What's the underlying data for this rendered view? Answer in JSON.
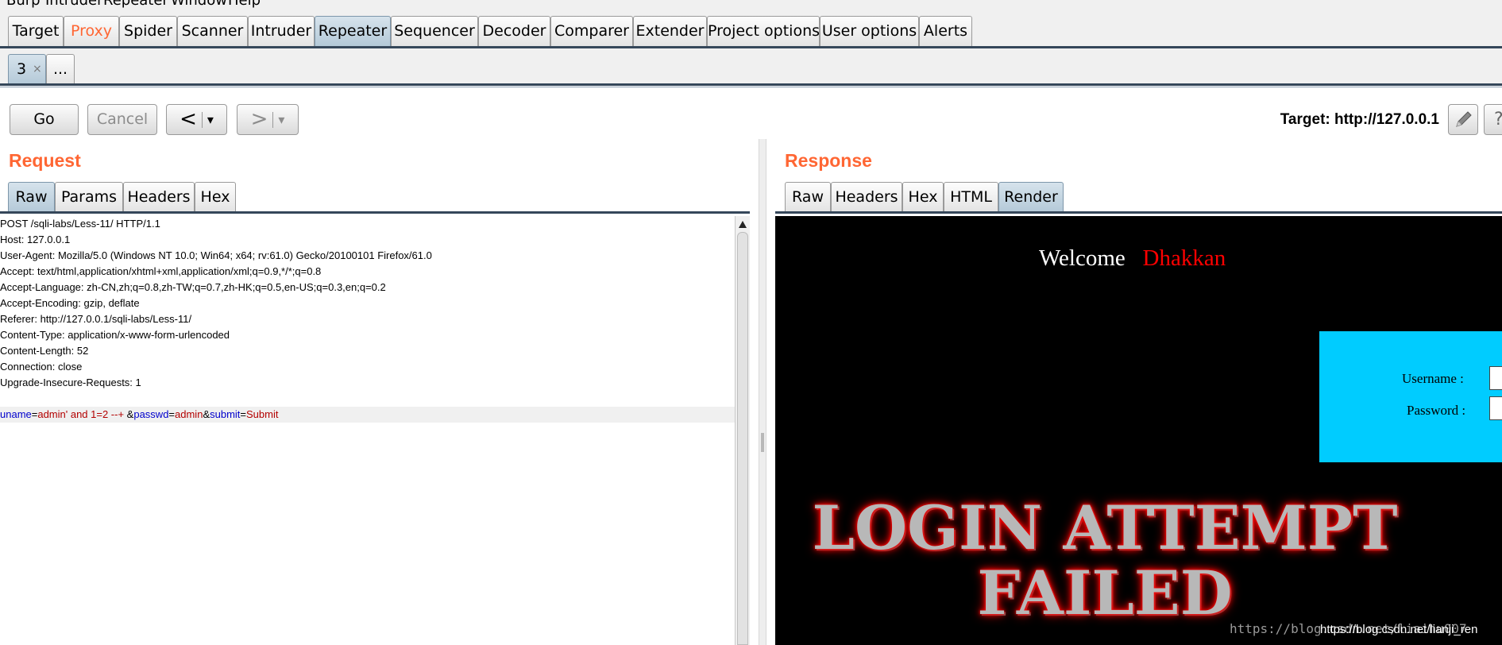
{
  "menubar": {
    "items": [
      "Burp",
      "Intruder",
      "Repeater",
      "Window",
      "Help"
    ]
  },
  "main_tabs": [
    "Target",
    "Proxy",
    "Spider",
    "Scanner",
    "Intruder",
    "Repeater",
    "Sequencer",
    "Decoder",
    "Comparer",
    "Extender",
    "Project options",
    "User options",
    "Alerts"
  ],
  "sub_tabs": {
    "tab_label": "3",
    "close_glyph": "×",
    "more_label": "..."
  },
  "toolbar": {
    "go_label": "Go",
    "cancel_label": "Cancel",
    "back_glyph": "<",
    "forward_glyph": ">",
    "dropdown_glyph": "▾",
    "target_text": "Target: http://127.0.0.1"
  },
  "request": {
    "title": "Request",
    "tabs": [
      "Raw",
      "Params",
      "Headers",
      "Hex"
    ],
    "lines": [
      "POST /sqli-labs/Less-11/ HTTP/1.1",
      "Host: 127.0.0.1",
      "User-Agent: Mozilla/5.0 (Windows NT 10.0; Win64; x64; rv:61.0) Gecko/20100101 Firefox/61.0",
      "Accept: text/html,application/xhtml+xml,application/xml;q=0.9,*/*;q=0.8",
      "Accept-Language: zh-CN,zh;q=0.8,zh-TW;q=0.7,zh-HK;q=0.5,en-US;q=0.3,en;q=0.2",
      "Accept-Encoding: gzip, deflate",
      "Referer: http://127.0.0.1/sqli-labs/Less-11/",
      "Content-Type: application/x-www-form-urlencoded",
      "Content-Length: 52",
      "Connection: close",
      "Upgrade-Insecure-Requests: 1"
    ],
    "body": {
      "k1": "uname",
      "eq": "=",
      "v1": "admin' and 1=2 --+ ",
      "amp": "&",
      "k2": "passwd",
      "v2": "admin",
      "k3": "submit",
      "v3": "Submit"
    }
  },
  "response": {
    "title": "Response",
    "tabs": [
      "Raw",
      "Headers",
      "Hex",
      "HTML",
      "Render"
    ],
    "render": {
      "welcome": "Welcome",
      "name": "Dhakkan",
      "username_label": "Username :",
      "password_label": "Password :",
      "failed_line1": "LOGIN ATTEMPT",
      "failed_line2": "FAILED"
    }
  },
  "watermark": {
    "text1": "https://blog.csdn.net/liaihu007",
    "text2": "https://blog.csdn.net/lianji_ren"
  },
  "colors": {
    "accent": "#ff6633",
    "proxy_tab": "#ff6633",
    "key_blue": "#0000cc",
    "value_red": "#b30000",
    "form_cyan": "#00ccff",
    "welcome_red": "#ff0000"
  }
}
